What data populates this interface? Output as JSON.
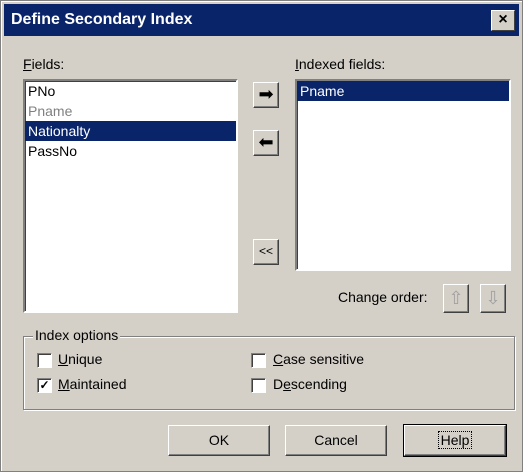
{
  "window": {
    "title": "Define Secondary Index",
    "close_label": "×"
  },
  "fields": {
    "label_prefix": "F",
    "label_rest": "ields:",
    "items": [
      "PNo",
      "Pname",
      "Nationalty",
      "PassNo"
    ]
  },
  "indexed": {
    "label_prefix": "I",
    "label_rest": "ndexed fields:",
    "items": [
      "Pname"
    ]
  },
  "buttons": {
    "add_arrow": "➡",
    "remove_arrow": "⬅",
    "remove_all": "<<",
    "move_up": "⇧",
    "move_down": "⇩",
    "ok": "OK",
    "cancel": "Cancel",
    "help": "Help"
  },
  "change_order_label": "Change order:",
  "index_options": {
    "title": "Index options",
    "unique": {
      "u": "U",
      "rest": "nique",
      "checked": false
    },
    "maintained": {
      "u": "M",
      "rest": "aintained",
      "checked": true
    },
    "case_sensitive": {
      "u": "C",
      "rest": "ase sensitive",
      "checked": false
    },
    "descending": {
      "pre": "D",
      "u": "e",
      "rest": "scending",
      "checked": false
    }
  },
  "colors": {
    "selection": "#0a246a",
    "face": "#d4d0c8"
  }
}
